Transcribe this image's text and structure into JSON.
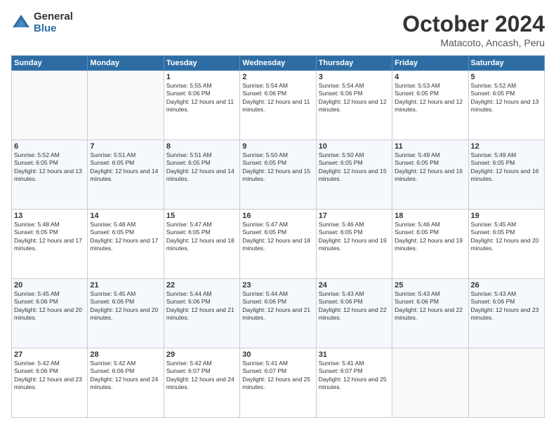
{
  "logo": {
    "general": "General",
    "blue": "Blue"
  },
  "title": "October 2024",
  "location": "Matacoto, Ancash, Peru",
  "weekdays": [
    "Sunday",
    "Monday",
    "Tuesday",
    "Wednesday",
    "Thursday",
    "Friday",
    "Saturday"
  ],
  "weeks": [
    [
      {
        "day": "",
        "sunrise": "",
        "sunset": "",
        "daylight": ""
      },
      {
        "day": "",
        "sunrise": "",
        "sunset": "",
        "daylight": ""
      },
      {
        "day": "1",
        "sunrise": "Sunrise: 5:55 AM",
        "sunset": "Sunset: 6:06 PM",
        "daylight": "Daylight: 12 hours and 11 minutes."
      },
      {
        "day": "2",
        "sunrise": "Sunrise: 5:54 AM",
        "sunset": "Sunset: 6:06 PM",
        "daylight": "Daylight: 12 hours and 11 minutes."
      },
      {
        "day": "3",
        "sunrise": "Sunrise: 5:54 AM",
        "sunset": "Sunset: 6:06 PM",
        "daylight": "Daylight: 12 hours and 12 minutes."
      },
      {
        "day": "4",
        "sunrise": "Sunrise: 5:53 AM",
        "sunset": "Sunset: 6:05 PM",
        "daylight": "Daylight: 12 hours and 12 minutes."
      },
      {
        "day": "5",
        "sunrise": "Sunrise: 5:52 AM",
        "sunset": "Sunset: 6:05 PM",
        "daylight": "Daylight: 12 hours and 13 minutes."
      }
    ],
    [
      {
        "day": "6",
        "sunrise": "Sunrise: 5:52 AM",
        "sunset": "Sunset: 6:05 PM",
        "daylight": "Daylight: 12 hours and 13 minutes."
      },
      {
        "day": "7",
        "sunrise": "Sunrise: 5:51 AM",
        "sunset": "Sunset: 6:05 PM",
        "daylight": "Daylight: 12 hours and 14 minutes."
      },
      {
        "day": "8",
        "sunrise": "Sunrise: 5:51 AM",
        "sunset": "Sunset: 6:05 PM",
        "daylight": "Daylight: 12 hours and 14 minutes."
      },
      {
        "day": "9",
        "sunrise": "Sunrise: 5:50 AM",
        "sunset": "Sunset: 6:05 PM",
        "daylight": "Daylight: 12 hours and 15 minutes."
      },
      {
        "day": "10",
        "sunrise": "Sunrise: 5:50 AM",
        "sunset": "Sunset: 6:05 PM",
        "daylight": "Daylight: 12 hours and 15 minutes."
      },
      {
        "day": "11",
        "sunrise": "Sunrise: 5:49 AM",
        "sunset": "Sunset: 6:05 PM",
        "daylight": "Daylight: 12 hours and 16 minutes."
      },
      {
        "day": "12",
        "sunrise": "Sunrise: 5:49 AM",
        "sunset": "Sunset: 6:05 PM",
        "daylight": "Daylight: 12 hours and 16 minutes."
      }
    ],
    [
      {
        "day": "13",
        "sunrise": "Sunrise: 5:48 AM",
        "sunset": "Sunset: 6:05 PM",
        "daylight": "Daylight: 12 hours and 17 minutes."
      },
      {
        "day": "14",
        "sunrise": "Sunrise: 5:48 AM",
        "sunset": "Sunset: 6:05 PM",
        "daylight": "Daylight: 12 hours and 17 minutes."
      },
      {
        "day": "15",
        "sunrise": "Sunrise: 5:47 AM",
        "sunset": "Sunset: 6:05 PM",
        "daylight": "Daylight: 12 hours and 18 minutes."
      },
      {
        "day": "16",
        "sunrise": "Sunrise: 5:47 AM",
        "sunset": "Sunset: 6:05 PM",
        "daylight": "Daylight: 12 hours and 18 minutes."
      },
      {
        "day": "17",
        "sunrise": "Sunrise: 5:46 AM",
        "sunset": "Sunset: 6:05 PM",
        "daylight": "Daylight: 12 hours and 19 minutes."
      },
      {
        "day": "18",
        "sunrise": "Sunrise: 5:46 AM",
        "sunset": "Sunset: 6:05 PM",
        "daylight": "Daylight: 12 hours and 19 minutes."
      },
      {
        "day": "19",
        "sunrise": "Sunrise: 5:45 AM",
        "sunset": "Sunset: 6:05 PM",
        "daylight": "Daylight: 12 hours and 20 minutes."
      }
    ],
    [
      {
        "day": "20",
        "sunrise": "Sunrise: 5:45 AM",
        "sunset": "Sunset: 6:06 PM",
        "daylight": "Daylight: 12 hours and 20 minutes."
      },
      {
        "day": "21",
        "sunrise": "Sunrise: 5:45 AM",
        "sunset": "Sunset: 6:06 PM",
        "daylight": "Daylight: 12 hours and 20 minutes."
      },
      {
        "day": "22",
        "sunrise": "Sunrise: 5:44 AM",
        "sunset": "Sunset: 6:06 PM",
        "daylight": "Daylight: 12 hours and 21 minutes."
      },
      {
        "day": "23",
        "sunrise": "Sunrise: 5:44 AM",
        "sunset": "Sunset: 6:06 PM",
        "daylight": "Daylight: 12 hours and 21 minutes."
      },
      {
        "day": "24",
        "sunrise": "Sunrise: 5:43 AM",
        "sunset": "Sunset: 6:06 PM",
        "daylight": "Daylight: 12 hours and 22 minutes."
      },
      {
        "day": "25",
        "sunrise": "Sunrise: 5:43 AM",
        "sunset": "Sunset: 6:06 PM",
        "daylight": "Daylight: 12 hours and 22 minutes."
      },
      {
        "day": "26",
        "sunrise": "Sunrise: 5:43 AM",
        "sunset": "Sunset: 6:06 PM",
        "daylight": "Daylight: 12 hours and 23 minutes."
      }
    ],
    [
      {
        "day": "27",
        "sunrise": "Sunrise: 5:42 AM",
        "sunset": "Sunset: 6:06 PM",
        "daylight": "Daylight: 12 hours and 23 minutes."
      },
      {
        "day": "28",
        "sunrise": "Sunrise: 5:42 AM",
        "sunset": "Sunset: 6:06 PM",
        "daylight": "Daylight: 12 hours and 24 minutes."
      },
      {
        "day": "29",
        "sunrise": "Sunrise: 5:42 AM",
        "sunset": "Sunset: 6:07 PM",
        "daylight": "Daylight: 12 hours and 24 minutes."
      },
      {
        "day": "30",
        "sunrise": "Sunrise: 5:41 AM",
        "sunset": "Sunset: 6:07 PM",
        "daylight": "Daylight: 12 hours and 25 minutes."
      },
      {
        "day": "31",
        "sunrise": "Sunrise: 5:41 AM",
        "sunset": "Sunset: 6:07 PM",
        "daylight": "Daylight: 12 hours and 25 minutes."
      },
      {
        "day": "",
        "sunrise": "",
        "sunset": "",
        "daylight": ""
      },
      {
        "day": "",
        "sunrise": "",
        "sunset": "",
        "daylight": ""
      }
    ]
  ]
}
